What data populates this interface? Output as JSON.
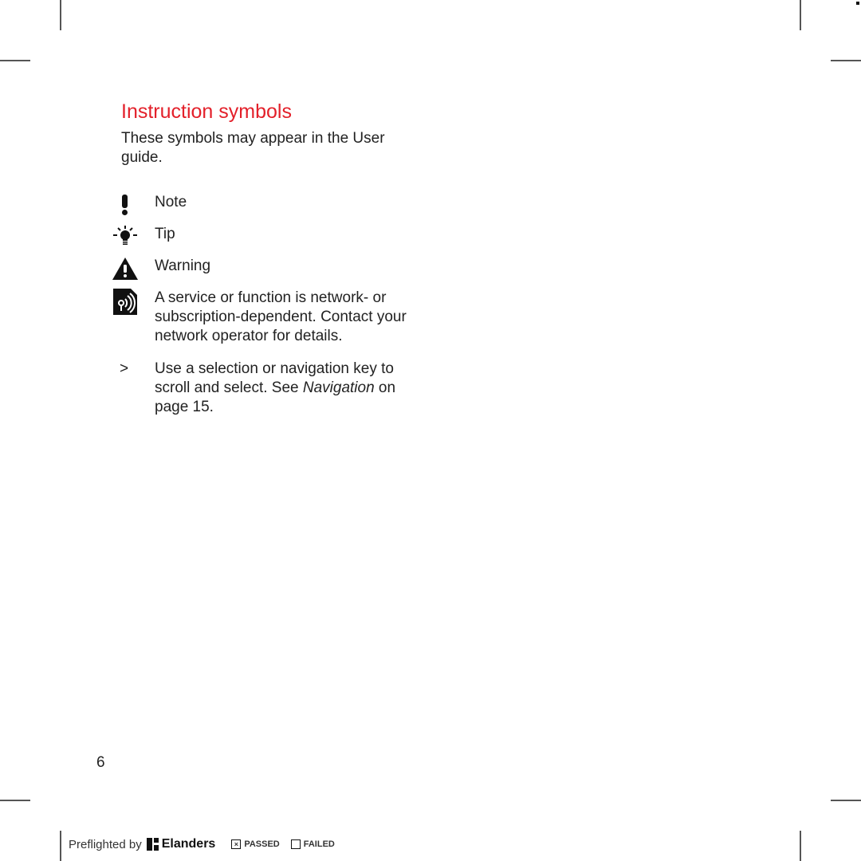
{
  "page": {
    "title": "Instruction symbols",
    "intro": "These symbols may appear in the User guide.",
    "symbols": [
      {
        "icon": "exclamation-icon",
        "label": "Note"
      },
      {
        "icon": "lightbulb-icon",
        "label": "Tip"
      },
      {
        "icon": "warning-triangle-icon",
        "label": "Warning"
      },
      {
        "icon": "network-service-icon",
        "label": "A service or function is network- or subscription-dependent. Contact your network operator for details."
      }
    ],
    "navigation": {
      "symbol": ">",
      "text_before": "Use a selection or navigation key to scroll and select. See ",
      "link_text": "Navigation",
      "text_after": " on page 15."
    },
    "page_number": "6"
  },
  "footer": {
    "preflighted_by": "Preflighted by",
    "brand": "Elanders",
    "passed_label": "PASSED",
    "failed_label": "FAILED",
    "passed_mark": "×",
    "accent_color": "#e3202a"
  }
}
